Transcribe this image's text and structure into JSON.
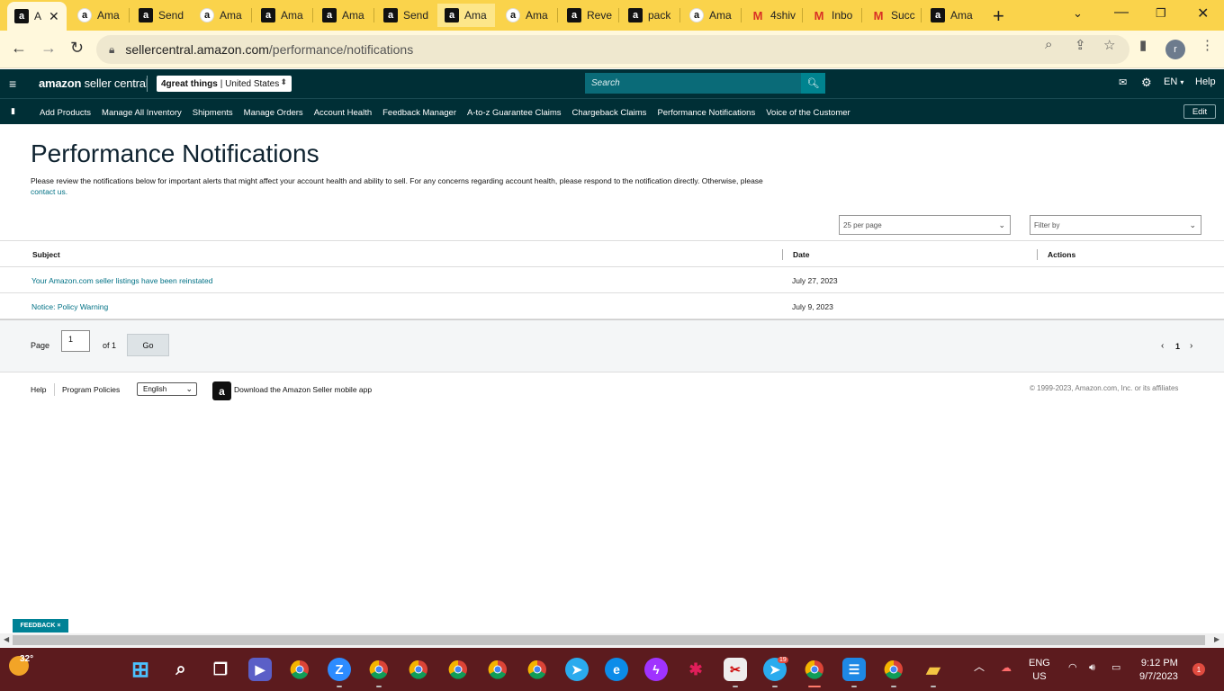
{
  "browser": {
    "tabs": [
      {
        "label": "A",
        "icon": "amazon-a-dark-icon",
        "active": true
      },
      {
        "label": "Ama",
        "icon": "amazon-smile-icon"
      },
      {
        "label": "Send",
        "icon": "amazon-a-dark-icon"
      },
      {
        "label": "Ama",
        "icon": "amazon-smile-icon"
      },
      {
        "label": "Ama",
        "icon": "amazon-a-dark-icon"
      },
      {
        "label": "Ama",
        "icon": "amazon-a-dark-icon"
      },
      {
        "label": "Send",
        "icon": "amazon-a-dark-icon"
      },
      {
        "label": "Ama",
        "icon": "amazon-a-dark-icon"
      },
      {
        "label": "Ama",
        "icon": "amazon-smile-icon"
      },
      {
        "label": "Reve",
        "icon": "amazon-a-dark-icon"
      },
      {
        "label": "pack",
        "icon": "amazon-a-dark-icon"
      },
      {
        "label": "Ama",
        "icon": "amazon-smile-icon"
      },
      {
        "label": "4shiv",
        "icon": "gmail-icon"
      },
      {
        "label": "Inbo",
        "icon": "gmail-icon"
      },
      {
        "label": "Succ",
        "icon": "gmail-icon"
      },
      {
        "label": "Ama",
        "icon": "amazon-a-dark-icon"
      }
    ],
    "url_domain": "sellercentral.amazon.com",
    "url_path": "/performance/notifications",
    "profile_initial": "r"
  },
  "header": {
    "logo_bold": "amazon",
    "logo_light": " seller central",
    "store_name": "4great things",
    "store_region": "| United States",
    "search_placeholder": "Search",
    "language": "EN",
    "help": "Help"
  },
  "nav": {
    "links": [
      "Add Products",
      "Manage All Inventory",
      "Shipments",
      "Manage Orders",
      "Account Health",
      "Feedback Manager",
      "A-to-z Guarantee Claims",
      "Chargeback Claims",
      "Performance Notifications",
      "Voice of the Customer"
    ],
    "edit": "Edit"
  },
  "main": {
    "title": "Performance Notifications",
    "intro": "Please review the notifications below for important alerts that might affect your account health and ability to sell. For any concerns regarding account health, please respond to the notification directly. Otherwise, please",
    "intro_link": "contact us.",
    "per_page": "25 per page",
    "filter_placeholder": "Filter by",
    "columns": {
      "subject": "Subject",
      "date": "Date",
      "actions": "Actions"
    },
    "rows": [
      {
        "subject": "Your Amazon.com seller listings have been reinstated",
        "date": "July 27, 2023"
      },
      {
        "subject": "Notice: Policy Warning",
        "date": "July 9, 2023"
      }
    ],
    "pager": {
      "page_label": "Page",
      "page_value": "1",
      "of_label": "of 1",
      "go": "Go",
      "current": "1"
    }
  },
  "footer": {
    "help": "Help",
    "program_policies": "Program Policies",
    "language": "English",
    "app_text": "Download the Amazon Seller mobile app",
    "copyright": "© 1999-2023, Amazon.com, Inc. or its affiliates"
  },
  "feedback": "FEEDBACK ×",
  "taskbar": {
    "temperature": "32°",
    "lang_top": "ENG",
    "lang_bottom": "US",
    "time": "9:12 PM",
    "date": "9/7/2023",
    "notifications": "1",
    "telegram_badge": "19"
  }
}
